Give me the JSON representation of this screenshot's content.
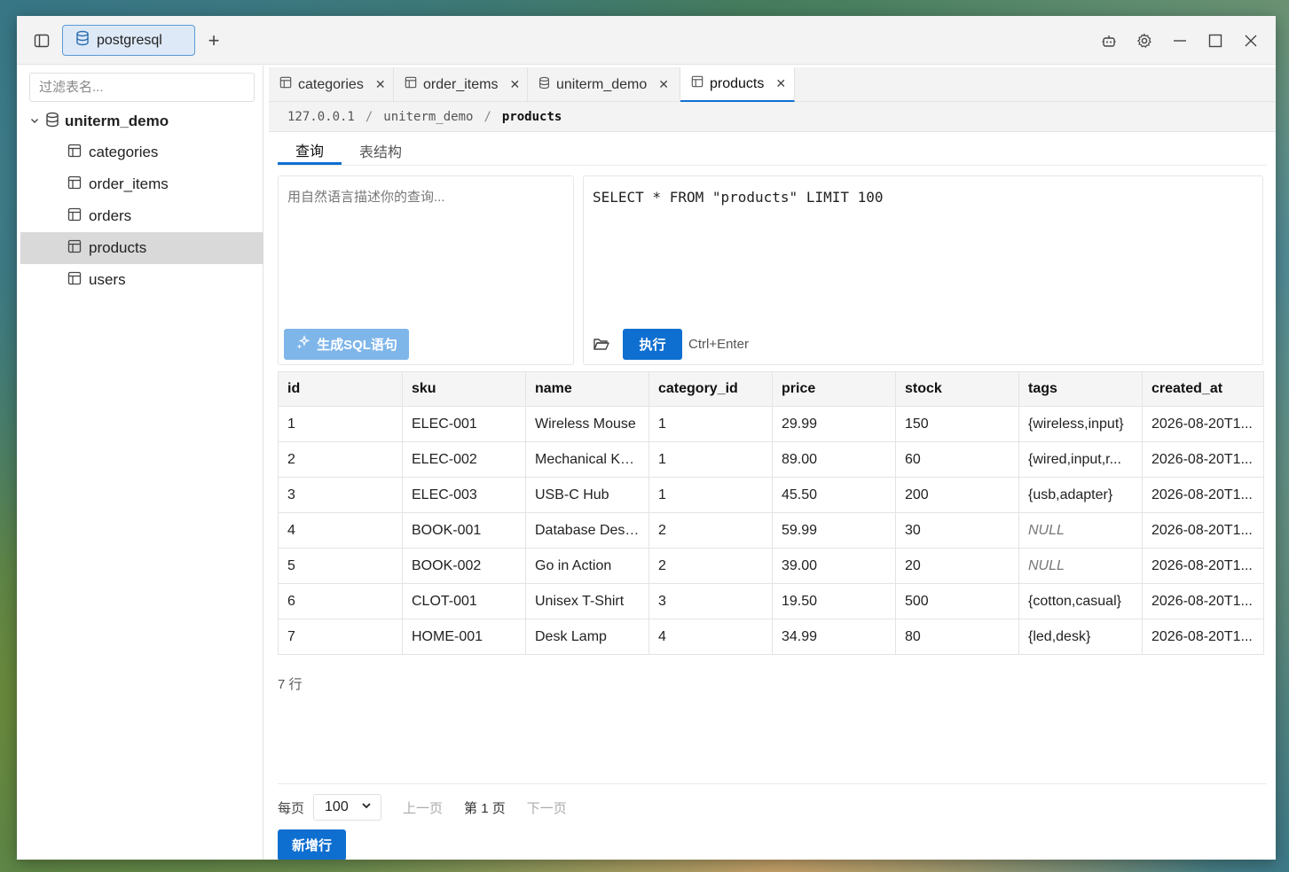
{
  "titlebar": {
    "connection_label": "postgresql",
    "add_tab": "+"
  },
  "sidebar": {
    "filter_placeholder": "过滤表名...",
    "database": "uniterm_demo",
    "tables": [
      "categories",
      "order_items",
      "orders",
      "products",
      "users"
    ],
    "active_table": "products"
  },
  "tabs": [
    {
      "label": "categories",
      "icon": "table-icon"
    },
    {
      "label": "order_items",
      "icon": "table-icon"
    },
    {
      "label": "uniterm_demo",
      "icon": "database-icon"
    },
    {
      "label": "products",
      "icon": "table-icon",
      "active": true
    }
  ],
  "breadcrumb": {
    "host": "127.0.0.1",
    "sep": "/",
    "database": "uniterm_demo",
    "table": "products"
  },
  "subtabs": {
    "query": "查询",
    "structure": "表结构"
  },
  "nl_query": {
    "placeholder": "用自然语言描述你的查询...",
    "generate_label": "生成SQL语句"
  },
  "sql_editor": {
    "sql": "SELECT * FROM \"products\" LIMIT 100",
    "run_label": "执行",
    "shortcut": "Ctrl+Enter"
  },
  "results": {
    "columns": [
      "id",
      "sku",
      "name",
      "category_id",
      "price",
      "stock",
      "tags",
      "created_at"
    ],
    "rows": [
      [
        "1",
        "ELEC-001",
        "Wireless Mouse",
        "1",
        "29.99",
        "150",
        "{wireless,input}",
        "2026-08-20T1..."
      ],
      [
        "2",
        "ELEC-002",
        "Mechanical Ke...",
        "1",
        "89.00",
        "60",
        "{wired,input,r...",
        "2026-08-20T1..."
      ],
      [
        "3",
        "ELEC-003",
        "USB-C Hub",
        "1",
        "45.50",
        "200",
        "{usb,adapter}",
        "2026-08-20T1..."
      ],
      [
        "4",
        "BOOK-001",
        "Database Desi...",
        "2",
        "59.99",
        "30",
        "NULL",
        "2026-08-20T1..."
      ],
      [
        "5",
        "BOOK-002",
        "Go in Action",
        "2",
        "39.00",
        "20",
        "NULL",
        "2026-08-20T1..."
      ],
      [
        "6",
        "CLOT-001",
        "Unisex T-Shirt",
        "3",
        "19.50",
        "500",
        "{cotton,casual}",
        "2026-08-20T1..."
      ],
      [
        "7",
        "HOME-001",
        "Desk Lamp",
        "4",
        "34.99",
        "80",
        "{led,desk}",
        "2026-08-20T1..."
      ]
    ],
    "row_count": "7 行"
  },
  "pagination": {
    "per_page_label": "每页",
    "per_page_value": "100",
    "prev_label": "上一页",
    "page_label": "第 1 页",
    "next_label": "下一页"
  },
  "add_row_label": "新增行",
  "colors": {
    "accent": "#0f6fd0",
    "accent_light": "#7fb6ea",
    "selection": "#d9d9d9"
  }
}
